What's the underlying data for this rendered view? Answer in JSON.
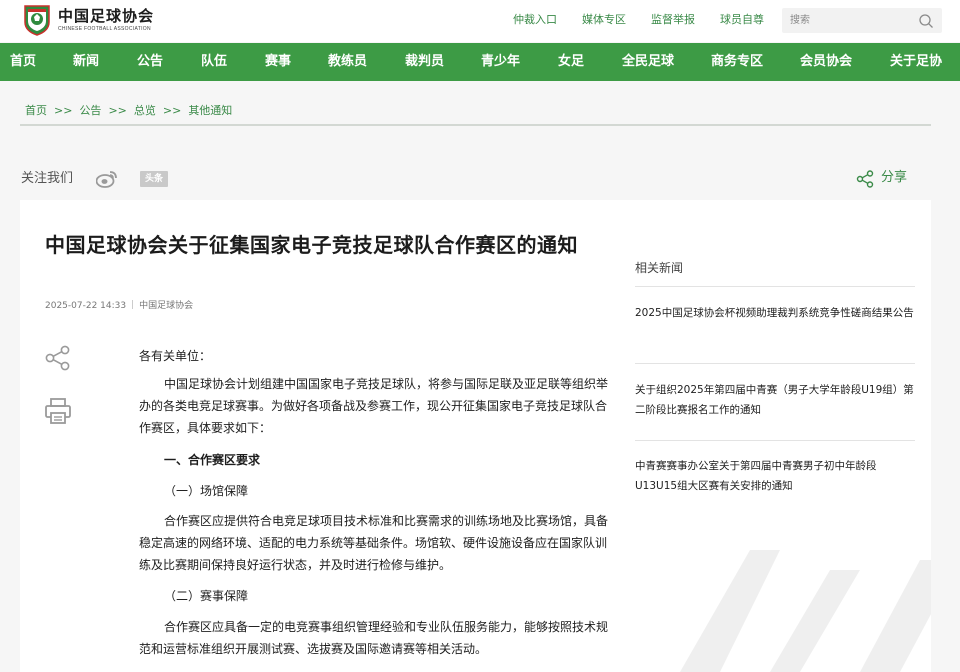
{
  "site": {
    "name_cn": "中国足球协会",
    "name_en": "CHINESE FOOTBALL ASSOCIATION"
  },
  "top_links": [
    "仲裁入口",
    "媒体专区",
    "监督举报",
    "球员自尊"
  ],
  "search": {
    "placeholder": "搜索"
  },
  "nav": [
    "首页",
    "新闻",
    "公告",
    "队伍",
    "赛事",
    "教练员",
    "裁判员",
    "青少年",
    "女足",
    "全民足球",
    "商务专区",
    "会员协会",
    "关于足协"
  ],
  "breadcrumb": [
    "首页",
    "公告",
    "总览",
    "其他通知"
  ],
  "breadcrumb_separator": ">>",
  "follow_label": "关注我们",
  "toutiao_label": "头条",
  "share_label": "分享",
  "article": {
    "title": "中国足球协会关于征集国家电子竞技足球队合作赛区的通知",
    "date": "2025-07-22 14:33",
    "source": "中国足球协会",
    "salutation": "各有关单位：",
    "para1": "中国足球协会计划组建中国国家电子竞技足球队，将参与国际足联及亚足联等组织举办的各类电竞足球赛事。为做好各项备战及参赛工作，现公开征集国家电子竞技足球队合作赛区，具体要求如下：",
    "heading1": "一、合作赛区要求",
    "sub1": "（一）场馆保障",
    "para2": "合作赛区应提供符合电竞足球项目技术标准和比赛需求的训练场地及比赛场馆，具备稳定高速的网络环境、适配的电力系统等基础条件。场馆软、硬件设施设备应在国家队训练及比赛期间保持良好运行状态，并及时进行检修与维护。",
    "sub2": "（二）赛事保障",
    "para3": "合作赛区应具备一定的电竞赛事组织管理经验和专业队伍服务能力，能够按照技术规范和运营标准组织开展测试赛、选拔赛及国际邀请赛等相关活动。"
  },
  "related": {
    "title": "相关新闻",
    "items": [
      "2025中国足球协会杯视频助理裁判系统竞争性磋商结果公告",
      "关于组织2025年第四届中青赛（男子大学年龄段U19组）第二阶段比赛报名工作的通知",
      "中青赛赛事办公室关于第四届中青赛男子初中年龄段U13U15组大区赛有关安排的通知"
    ]
  },
  "colors": {
    "brand_green": "#3d9b45",
    "link_green": "#3a8a48"
  }
}
